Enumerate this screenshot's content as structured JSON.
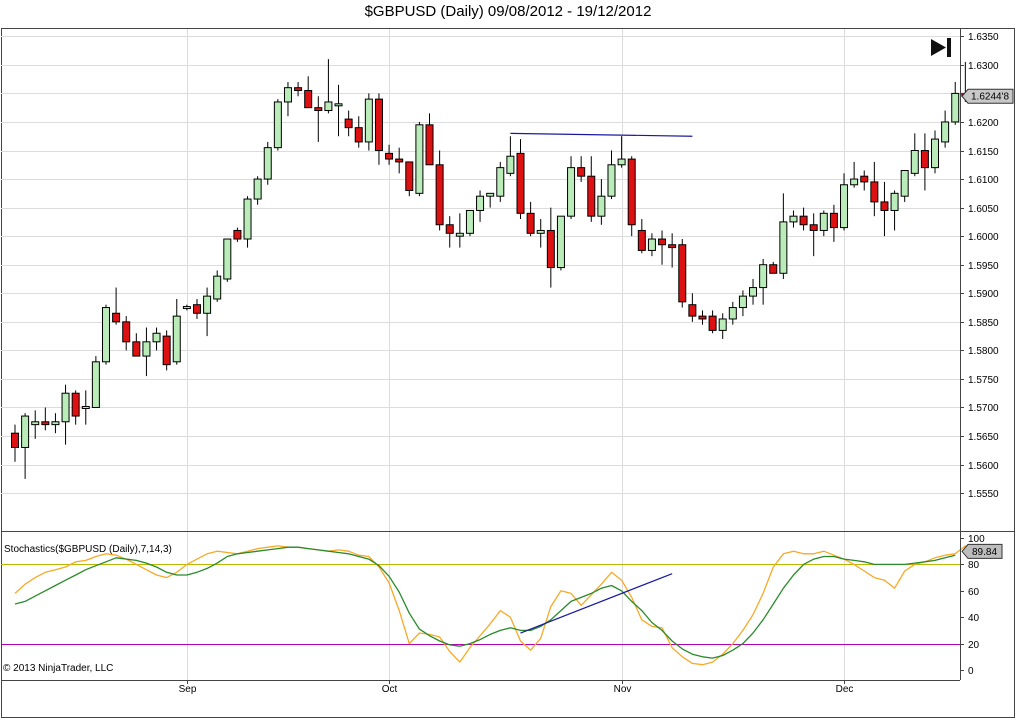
{
  "title": "$GBPUSD (Daily)  09/08/2012 - 19/12/2012",
  "copyright": "© 2013 NinjaTrader, LLC",
  "price_flag": "1.6244'8",
  "stoch_flag": "89.84",
  "colors": {
    "up": "#b9ecb9",
    "down": "#dd1111",
    "k_line": "#f7a928",
    "d_line": "#2a8a2a",
    "level80": "#b8b800",
    "level20": "#b400b4",
    "trendline": "#1a1aa0",
    "grid": "#dcdcdc"
  },
  "chart_data": [
    {
      "type": "candlestick",
      "title": "$GBPUSD (Daily)  09/08/2012 - 19/12/2012",
      "ylim": [
        1.551,
        1.6354
      ],
      "y_ticks": [
        "1.6350",
        "1.6300",
        "1.6250",
        "1.6200",
        "1.6150",
        "1.6100",
        "1.6050",
        "1.6000",
        "1.5950",
        "1.5900",
        "1.5850",
        "1.5800",
        "1.5750",
        "1.5700",
        "1.5650",
        "1.5600",
        "1.5550"
      ],
      "x_ticks": [
        {
          "label": "Sep",
          "index": 17
        },
        {
          "label": "Oct",
          "index": 37
        },
        {
          "label": "Nov",
          "index": 60
        },
        {
          "label": "Dec",
          "index": 82
        }
      ],
      "last_price_label": "1.6244'8",
      "ohlc": [
        [
          1.5655,
          1.567,
          1.5605,
          1.563
        ],
        [
          1.563,
          1.569,
          1.5575,
          1.5685
        ],
        [
          1.567,
          1.5695,
          1.5645,
          1.5675
        ],
        [
          1.5675,
          1.57,
          1.566,
          1.567
        ],
        [
          1.567,
          1.569,
          1.5655,
          1.5675
        ],
        [
          1.5675,
          1.574,
          1.5635,
          1.5725
        ],
        [
          1.5725,
          1.573,
          1.567,
          1.5685
        ],
        [
          1.57,
          1.573,
          1.567,
          1.57
        ],
        [
          1.57,
          1.579,
          1.57,
          1.578
        ],
        [
          1.578,
          1.588,
          1.5775,
          1.5875
        ],
        [
          1.5865,
          1.591,
          1.5845,
          1.585
        ],
        [
          1.585,
          1.586,
          1.58,
          1.5815
        ],
        [
          1.5815,
          1.583,
          1.579,
          1.579
        ],
        [
          1.579,
          1.584,
          1.5755,
          1.5815
        ],
        [
          1.5815,
          1.584,
          1.58,
          1.583
        ],
        [
          1.5825,
          1.5835,
          1.5765,
          1.5775
        ],
        [
          1.578,
          1.589,
          1.5775,
          1.586
        ],
        [
          1.5875,
          1.588,
          1.587,
          1.5875
        ],
        [
          1.588,
          1.589,
          1.5855,
          1.5865
        ],
        [
          1.5865,
          1.591,
          1.5825,
          1.5895
        ],
        [
          1.589,
          1.594,
          1.5885,
          1.593
        ],
        [
          1.5925,
          1.599,
          1.592,
          1.5995
        ],
        [
          1.601,
          1.6015,
          1.599,
          1.5995
        ],
        [
          1.5995,
          1.607,
          1.598,
          1.6065
        ],
        [
          1.6065,
          1.6105,
          1.6055,
          1.61
        ],
        [
          1.61,
          1.6165,
          1.609,
          1.6155
        ],
        [
          1.6155,
          1.624,
          1.615,
          1.6235
        ],
        [
          1.6235,
          1.627,
          1.621,
          1.626
        ],
        [
          1.626,
          1.627,
          1.6245,
          1.6255
        ],
        [
          1.6255,
          1.628,
          1.6225,
          1.6225
        ],
        [
          1.6225,
          1.6245,
          1.6165,
          1.622
        ],
        [
          1.622,
          1.631,
          1.6215,
          1.6235
        ],
        [
          1.623,
          1.6265,
          1.6175,
          1.623
        ],
        [
          1.6205,
          1.622,
          1.6175,
          1.619
        ],
        [
          1.619,
          1.621,
          1.6155,
          1.6165
        ],
        [
          1.6165,
          1.625,
          1.615,
          1.624
        ],
        [
          1.624,
          1.625,
          1.6125,
          1.615
        ],
        [
          1.6145,
          1.616,
          1.6125,
          1.6135
        ],
        [
          1.6135,
          1.6155,
          1.611,
          1.613
        ],
        [
          1.613,
          1.613,
          1.607,
          1.608
        ],
        [
          1.6075,
          1.62,
          1.607,
          1.6195
        ],
        [
          1.6195,
          1.6215,
          1.6125,
          1.6125
        ],
        [
          1.6125,
          1.615,
          1.601,
          1.602
        ],
        [
          1.602,
          1.6035,
          1.598,
          1.6005
        ],
        [
          1.6,
          1.604,
          1.598,
          1.6005
        ],
        [
          1.6005,
          1.6045,
          1.6,
          1.6045
        ],
        [
          1.6045,
          1.608,
          1.6025,
          1.607
        ],
        [
          1.607,
          1.6075,
          1.605,
          1.6075
        ],
        [
          1.607,
          1.613,
          1.606,
          1.612
        ],
        [
          1.611,
          1.6175,
          1.6105,
          1.614
        ],
        [
          1.6145,
          1.617,
          1.603,
          1.604
        ],
        [
          1.604,
          1.606,
          1.6,
          1.6005
        ],
        [
          1.6005,
          1.603,
          1.598,
          1.601
        ],
        [
          1.601,
          1.605,
          1.591,
          1.5945
        ],
        [
          1.5945,
          1.6035,
          1.594,
          1.6035
        ],
        [
          1.6035,
          1.614,
          1.603,
          1.612
        ],
        [
          1.612,
          1.614,
          1.6095,
          1.6105
        ],
        [
          1.6105,
          1.614,
          1.6025,
          1.6035
        ],
        [
          1.6035,
          1.61,
          1.602,
          1.607
        ],
        [
          1.607,
          1.615,
          1.6065,
          1.6125
        ],
        [
          1.6125,
          1.6175,
          1.612,
          1.6135
        ],
        [
          1.6135,
          1.614,
          1.6,
          1.602
        ],
        [
          1.601,
          1.603,
          1.597,
          1.5975
        ],
        [
          1.5975,
          1.6005,
          1.5965,
          1.5995
        ],
        [
          1.5995,
          1.601,
          1.595,
          1.5985
        ],
        [
          1.5985,
          1.6005,
          1.5945,
          1.598
        ],
        [
          1.5985,
          1.5995,
          1.5875,
          1.5885
        ],
        [
          1.588,
          1.59,
          1.585,
          1.586
        ],
        [
          1.586,
          1.587,
          1.5845,
          1.5855
        ],
        [
          1.586,
          1.587,
          1.583,
          1.5835
        ],
        [
          1.5835,
          1.5865,
          1.582,
          1.5855
        ],
        [
          1.5855,
          1.5885,
          1.5845,
          1.5875
        ],
        [
          1.5875,
          1.5905,
          1.586,
          1.5895
        ],
        [
          1.5895,
          1.5925,
          1.588,
          1.591
        ],
        [
          1.591,
          1.596,
          1.588,
          1.595
        ],
        [
          1.595,
          1.5955,
          1.5935,
          1.5935
        ],
        [
          1.5935,
          1.6075,
          1.5925,
          1.6025
        ],
        [
          1.6025,
          1.6045,
          1.6015,
          1.6035
        ],
        [
          1.6035,
          1.605,
          1.601,
          1.602
        ],
        [
          1.602,
          1.604,
          1.5965,
          1.601
        ],
        [
          1.601,
          1.6045,
          1.6,
          1.604
        ],
        [
          1.604,
          1.6055,
          1.599,
          1.6015
        ],
        [
          1.6015,
          1.611,
          1.601,
          1.609
        ],
        [
          1.609,
          1.613,
          1.6085,
          1.61
        ],
        [
          1.6105,
          1.6115,
          1.608,
          1.6095
        ],
        [
          1.6095,
          1.613,
          1.6035,
          1.606
        ],
        [
          1.606,
          1.6095,
          1.6,
          1.6045
        ],
        [
          1.6045,
          1.608,
          1.601,
          1.6075
        ],
        [
          1.607,
          1.6115,
          1.606,
          1.6115
        ],
        [
          1.611,
          1.618,
          1.6105,
          1.615
        ],
        [
          1.615,
          1.618,
          1.608,
          1.612
        ],
        [
          1.612,
          1.6185,
          1.611,
          1.617
        ],
        [
          1.6165,
          1.622,
          1.6155,
          1.62
        ],
        [
          1.62,
          1.627,
          1.6195,
          1.625
        ],
        [
          1.625,
          1.6305,
          1.6235,
          1.6245
        ]
      ],
      "trendline": {
        "from": [
          49,
          1.618
        ],
        "to": [
          67,
          1.6175
        ]
      }
    },
    {
      "type": "line",
      "title": "Stochastics($GBPUSD (Daily),7,14,3)",
      "ylim": [
        0,
        100
      ],
      "y_ticks": [
        0,
        20,
        40,
        60,
        80,
        100
      ],
      "levels": [
        80,
        20
      ],
      "last_value_label": "89.84",
      "series": [
        {
          "name": "K",
          "values": [
            58,
            65,
            70,
            74,
            76,
            78,
            82,
            83,
            86,
            88,
            87,
            84,
            80,
            76,
            72,
            70,
            74,
            80,
            84,
            88,
            90,
            89,
            88,
            90,
            92,
            93,
            94,
            93,
            93,
            92,
            91,
            90,
            91,
            90,
            87,
            86,
            78,
            66,
            45,
            20,
            28,
            27,
            25,
            14,
            6,
            17,
            26,
            35,
            45,
            40,
            22,
            15,
            24,
            48,
            60,
            58,
            49,
            57,
            65,
            74,
            68,
            55,
            38,
            33,
            32,
            17,
            10,
            5,
            4,
            6,
            12,
            20,
            30,
            42,
            58,
            78,
            88,
            90,
            88,
            88,
            90,
            87,
            84,
            80,
            75,
            70,
            68,
            62,
            75,
            80,
            82,
            85,
            87,
            88,
            94,
            90
          ]
        },
        {
          "name": "D",
          "values": [
            50,
            52,
            56,
            60,
            64,
            68,
            72,
            76,
            79,
            82,
            85,
            84,
            83,
            81,
            78,
            74,
            72,
            72,
            74,
            77,
            81,
            86,
            88,
            89,
            90,
            91,
            92,
            93,
            93,
            92,
            91,
            90,
            89,
            88,
            86,
            84,
            79,
            71,
            59,
            43,
            31,
            26,
            22,
            19,
            18,
            20,
            23,
            27,
            30,
            32,
            30,
            30,
            33,
            38,
            45,
            52,
            55,
            58,
            62,
            64,
            60,
            52,
            45,
            36,
            30,
            22,
            16,
            12,
            10,
            9,
            11,
            15,
            20,
            28,
            38,
            50,
            62,
            72,
            80,
            84,
            86,
            86,
            84,
            83,
            82,
            80,
            80,
            80,
            80,
            81,
            82,
            83,
            85,
            87
          ]
        }
      ],
      "trendline": {
        "from": [
          50,
          28
        ],
        "to": [
          65,
          73
        ]
      }
    }
  ]
}
